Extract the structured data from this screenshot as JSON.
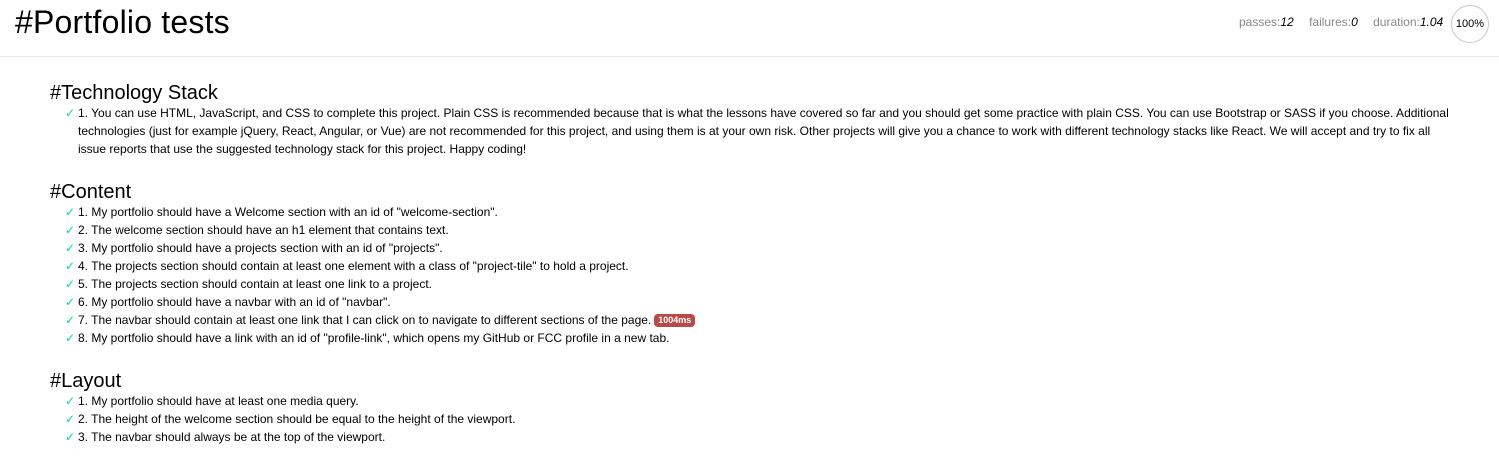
{
  "header": {
    "title": "#Portfolio tests",
    "passes_label": "passes:",
    "passes_value": "12",
    "failures_label": "failures:",
    "failures_value": "0",
    "duration_label": "duration:",
    "duration_value": "1.04",
    "progress": "100%"
  },
  "icons": {
    "pass": "checkmark-icon"
  },
  "colors": {
    "pass": "#00d6b2",
    "slow_badge": "#b94a48"
  },
  "suites": [
    {
      "title": "#Technology Stack",
      "tests": [
        {
          "text": "1. You can use HTML, JavaScript, and CSS to complete this project. Plain CSS is recommended because that is what the lessons have covered so far and you should get some practice with plain CSS. You can use Bootstrap or SASS if you choose. Additional technologies (just for example jQuery, React, Angular, or Vue) are not recommended for this project, and using them is at your own risk. Other projects will give you a chance to work with different technology stacks like React. We will accept and try to fix all issue reports that use the suggested technology stack for this project. Happy coding!"
        }
      ]
    },
    {
      "title": "#Content",
      "tests": [
        {
          "text": "1. My portfolio should have a Welcome section with an id of \"welcome-section\"."
        },
        {
          "text": "2. The welcome section should have an h1 element that contains text."
        },
        {
          "text": "3. My portfolio should have a projects section with an id of \"projects\"."
        },
        {
          "text": "4. The projects section should contain at least one element with a class of \"project-tile\" to hold a project."
        },
        {
          "text": "5. The projects section should contain at least one link to a project."
        },
        {
          "text": "6. My portfolio should have a navbar with an id of \"navbar\"."
        },
        {
          "text": "7. The navbar should contain at least one link that I can click on to navigate to different sections of the page.",
          "duration": "1004ms"
        },
        {
          "text": "8. My portfolio should have a link with an id of \"profile-link\", which opens my GitHub or FCC profile in a new tab."
        }
      ]
    },
    {
      "title": "#Layout",
      "tests": [
        {
          "text": "1. My portfolio should have at least one media query."
        },
        {
          "text": "2. The height of the welcome section should be equal to the height of the viewport."
        },
        {
          "text": "3. The navbar should always be at the top of the viewport."
        }
      ]
    }
  ]
}
